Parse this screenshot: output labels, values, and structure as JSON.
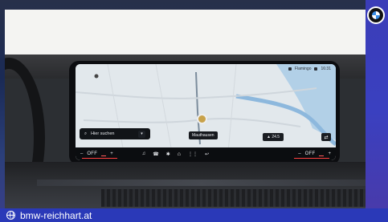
{
  "caption": {
    "site": "bmw-reichhart.at"
  },
  "brand": {
    "logo": "bmw-roundel-icon"
  },
  "nav_screen": {
    "status": {
      "station": "Flamingo",
      "time": "16:31"
    },
    "search_placeholder": "Hier suchen",
    "location_label": "Mauthausen",
    "temperature": "24.5",
    "climate_left": {
      "minus": "–",
      "state": "OFF",
      "plus": "+"
    },
    "climate_right": {
      "minus": "–",
      "state": "OFF",
      "plus": "+"
    }
  },
  "colors": {
    "caption_bg": "#2a39b8",
    "accent_red": "#ff4040",
    "map_bg": "#dfe5ea"
  }
}
